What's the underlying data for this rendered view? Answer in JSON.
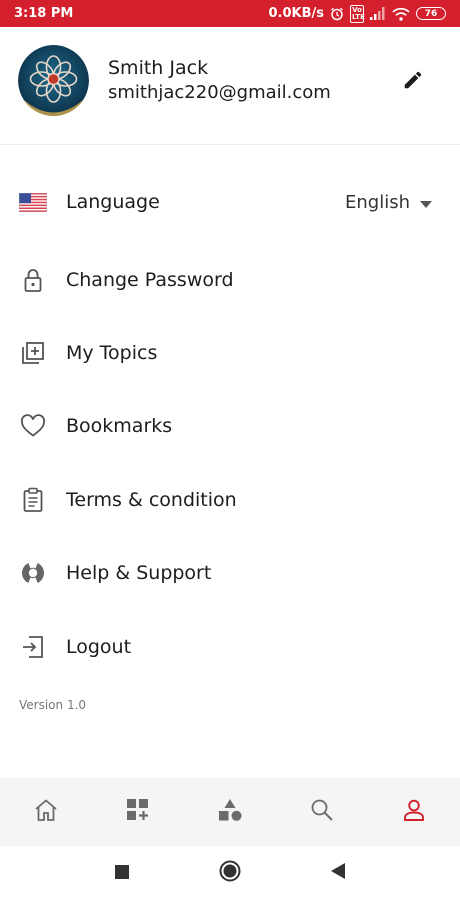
{
  "status_bar": {
    "time": "3:18 PM",
    "network_speed": "0.0KB/s",
    "volte_label": "Vo LTE",
    "battery": "76",
    "background": "#d3202c"
  },
  "profile": {
    "name": "Smith Jack",
    "email": "smithjac220@gmail.com",
    "edit_icon": "pencil-icon"
  },
  "menu": {
    "language": {
      "label": "Language",
      "value": "English",
      "icon": "us-flag-icon"
    },
    "items": [
      {
        "label": "Change Password",
        "icon": "lock-icon"
      },
      {
        "label": "My Topics",
        "icon": "library-add-icon"
      },
      {
        "label": "Bookmarks",
        "icon": "heart-icon"
      },
      {
        "label": "Terms & condition",
        "icon": "clipboard-icon"
      },
      {
        "label": "Help & Support",
        "icon": "lifebuoy-icon"
      },
      {
        "label": "Logout",
        "icon": "logout-icon"
      }
    ]
  },
  "version": "Version 1.0",
  "bottom_nav": {
    "items": [
      "home-icon",
      "add-grid-icon",
      "shapes-icon",
      "search-icon",
      "profile-icon"
    ],
    "active_index": 4,
    "active_color": "#d3202c",
    "inactive_color": "#6b6b6b"
  },
  "system_nav": [
    "recent-apps-icon",
    "home-circle-icon",
    "back-icon"
  ]
}
